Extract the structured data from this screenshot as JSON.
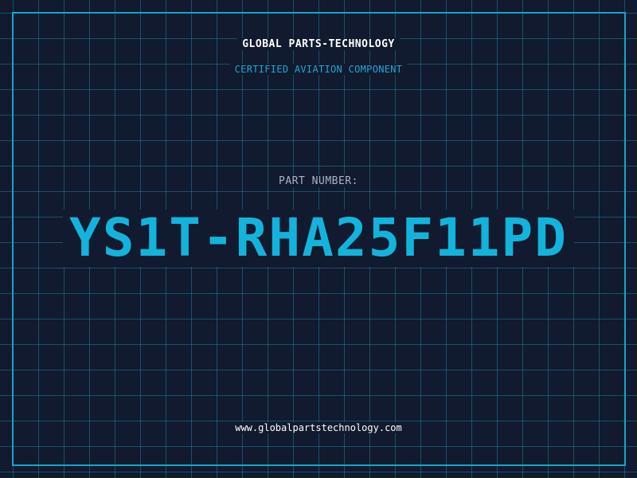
{
  "brand": {
    "name": "GLOBAL PARTS-TECHNOLOGY",
    "tagline": "CERTIFIED AVIATION COMPONENT"
  },
  "part": {
    "label": "PART NUMBER:",
    "number": "YS1T-RHA25F11PD"
  },
  "footer": {
    "url": "www.globalpartstechnology.com"
  },
  "colors": {
    "background": "#111a2e",
    "grid": "#1b7fa0",
    "accent": "#12b4dc",
    "label": "#a9b4c6",
    "text": "#ffffff"
  }
}
